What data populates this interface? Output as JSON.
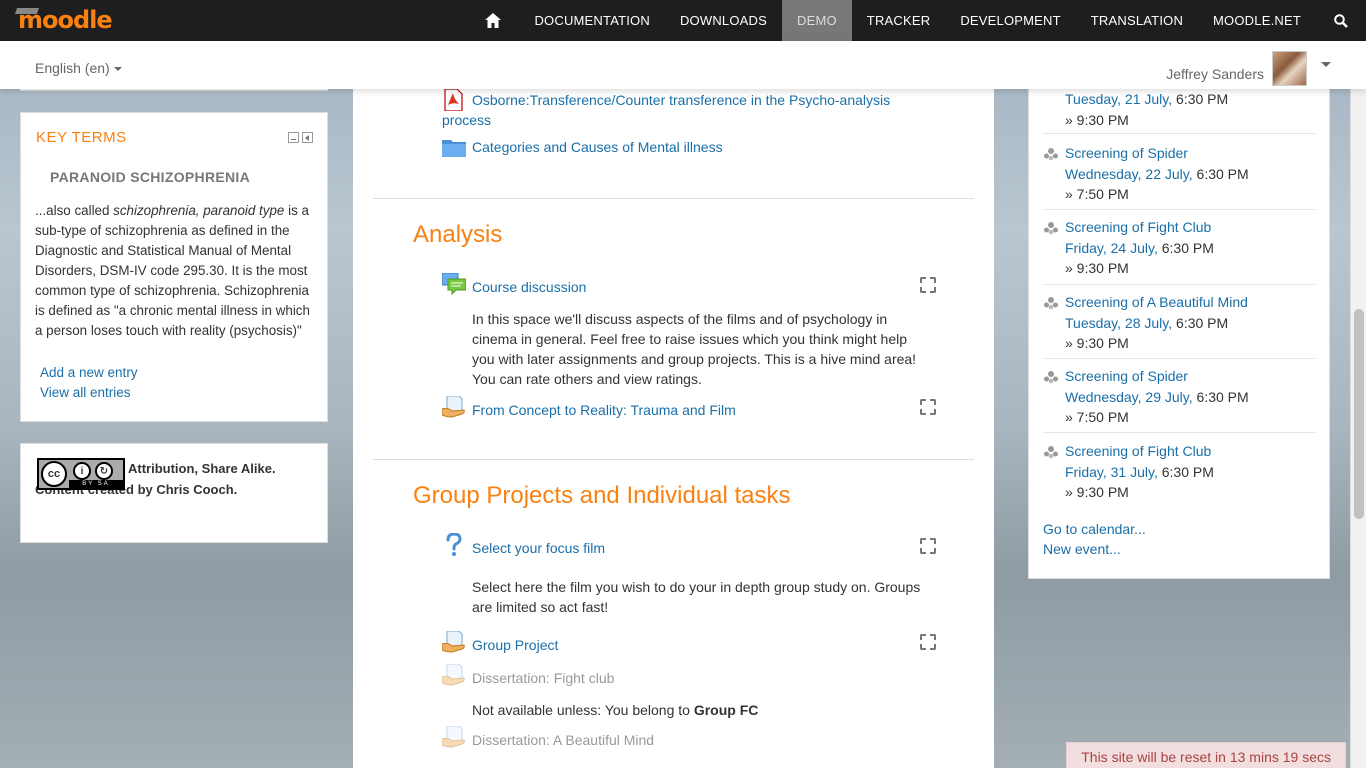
{
  "nav": {
    "logo": "moodle",
    "items": [
      "DOCUMENTATION",
      "DOWNLOADS",
      "DEMO",
      "TRACKER",
      "DEVELOPMENT",
      "TRANSLATION",
      "MOODLE.NET"
    ],
    "active": "DEMO"
  },
  "subbar": {
    "language": "English (en)",
    "user_name": "Jeffrey Sanders"
  },
  "key_terms": {
    "title": "KEY TERMS",
    "term": "PARANOID SCHIZOPHRENIA",
    "def_pre": "...also called ",
    "def_em": "schizophrenia, paranoid type",
    "def_post": " is a sub-type of schizophrenia as defined in the Diagnostic and Statistical Manual of Mental Disorders, DSM-IV code 295.30. It is the most common type of schizophrenia. Schizophrenia is defined as \"a chronic mental illness in which a person loses touch with reality (psychosis)\"",
    "add_entry": "Add a new entry",
    "view_all": "View all entries"
  },
  "license": {
    "badge_text": "BY SA",
    "text": "Attribution, Share Alike. Content created by Chris Cooch."
  },
  "main": {
    "top_resources": [
      {
        "title": "Osborne:Transference/Counter transference in the Psycho-analysis process",
        "icon": "pdf-icon"
      },
      {
        "title": "Categories and Causes of Mental illness",
        "icon": "folder-icon"
      }
    ],
    "analysis": {
      "title": "Analysis",
      "forum": "Course discussion",
      "forum_desc": "In this space we'll discuss aspects of the films and of psychology in cinema in general. Feel free to raise issues which you think might help you with later assignments and group projects. This is a hive mind area! You can rate others and view ratings.",
      "assignment": "From Concept to Reality: Trauma and Film"
    },
    "group": {
      "title": "Group Projects and Individual tasks",
      "choice": "Select your focus film",
      "choice_desc": "Select here the film you wish to do your in depth group study on. Groups are limited so act fast!",
      "group_project": "Group Project",
      "dissertation1": "Dissertation: Fight club",
      "restriction1_pre": "Not available unless: You belong to ",
      "restriction1_group": "Group FC",
      "dissertation2": "Dissertation: A Beautiful Mind"
    }
  },
  "events": {
    "partial_first": {
      "date": "Tuesday, 21 July,",
      "time": "6:30 PM",
      "end": "» 9:30 PM"
    },
    "items": [
      {
        "title": "Screening of Spider",
        "date": "Wednesday, 22 July,",
        "time": "6:30 PM",
        "end": "» 7:50 PM"
      },
      {
        "title": "Screening of Fight Club",
        "date": "Friday, 24 July,",
        "time": "6:30 PM",
        "end": "» 9:30 PM"
      },
      {
        "title": "Screening of A Beautiful Mind",
        "date": "Tuesday, 28 July,",
        "time": "6:30 PM",
        "end": "» 9:30 PM"
      },
      {
        "title": "Screening of Spider",
        "date": "Wednesday, 29 July,",
        "time": "6:30 PM",
        "end": "» 7:50 PM"
      },
      {
        "title": "Screening of Fight Club",
        "date": "Friday, 31 July,",
        "time": "6:30 PM",
        "end": "» 9:30 PM"
      }
    ],
    "goto_calendar": "Go to calendar...",
    "new_event": "New event..."
  },
  "reset_notice": "This site will be reset in 13 mins 19 secs",
  "colors": {
    "accent": "#f98012",
    "link": "#1a6fa8",
    "navbar": "#1e1e1e"
  }
}
